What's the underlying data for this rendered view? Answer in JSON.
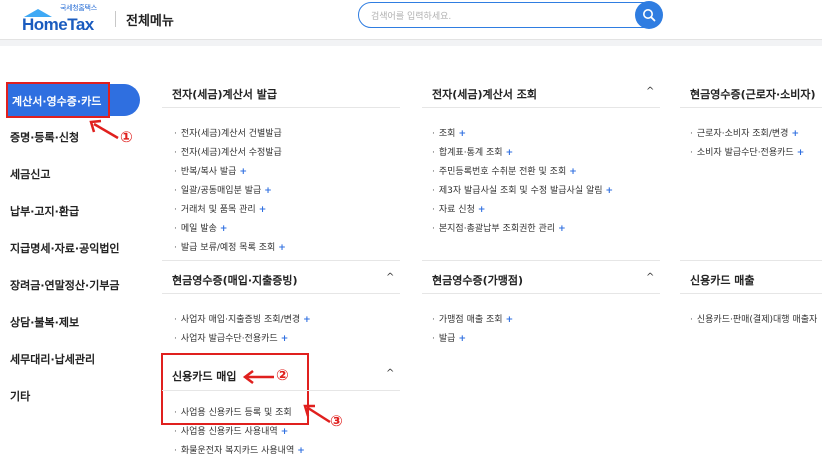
{
  "header": {
    "logo_sub": "국세청홈택스",
    "logo_text": "HomeTax",
    "title": "전체메뉴",
    "search_placeholder": "검색어를 입력하세요."
  },
  "sidebar": {
    "items": [
      "계산서·영수증·카드",
      "증명·등록·신청",
      "세금신고",
      "납부·고지·환급",
      "지급명세·자료·공익법인",
      "장려금·연말정산·기부금",
      "상담·불복·제보",
      "세무대리·납세관리",
      "기타"
    ]
  },
  "columns": {
    "c1": {
      "title": "전자(세금)계산서 발급",
      "items": [
        {
          "label": "전자(세금)계산서 건별발급",
          "plus": ""
        },
        {
          "label": "전자(세금)계산서 수정발급",
          "plus": ""
        },
        {
          "label": "반복/복사 발급",
          "plus": "+"
        },
        {
          "label": "일괄/공동매입분 발급",
          "plus": "+"
        },
        {
          "label": "거래처 및 품목 관리",
          "plus": "+"
        },
        {
          "label": "메일 발송",
          "plus": "+"
        },
        {
          "label": "발급 보류/예정 목록 조회",
          "plus": "+"
        }
      ]
    },
    "c2": {
      "title": "전자(세금)계산서 조회",
      "items": [
        {
          "label": "조회",
          "plus": "+"
        },
        {
          "label": "합계표·통계 조회",
          "plus": "+"
        },
        {
          "label": "주민등록번호 수취분 전환 및 조회",
          "plus": "+"
        },
        {
          "label": "제3자 발급사실 조회 및 수정 발급사실 알림",
          "plus": "+"
        },
        {
          "label": "자료 신청",
          "plus": "+"
        },
        {
          "label": "본지점·총괄납부 조회권한 관리",
          "plus": "+"
        }
      ]
    },
    "c3": {
      "title": "현금영수증(근로자·소비자)",
      "items": [
        {
          "label": "근로자·소비자 조회/변경",
          "plus": "+"
        },
        {
          "label": "소비자 발급수단·전용카드",
          "plus": "+"
        }
      ]
    },
    "c4": {
      "title": "현금영수증(매입·지출증빙)",
      "items": [
        {
          "label": "사업자 매입·지출증빙 조회/변경",
          "plus": "+"
        },
        {
          "label": "사업자 발급수단·전용카드",
          "plus": "+"
        }
      ]
    },
    "c5": {
      "title": "현금영수증(가맹점)",
      "items": [
        {
          "label": "가맹점 매출 조회",
          "plus": "+"
        },
        {
          "label": "발급",
          "plus": "+"
        }
      ]
    },
    "c6": {
      "title": "신용카드 매출",
      "items": [
        {
          "label": "신용카드·판매(결제)대행 매출자",
          "plus": ""
        }
      ]
    },
    "c7": {
      "title": "신용카드 매입",
      "items": [
        {
          "label": "사업용 신용카드 등록 및 조회",
          "plus": ""
        },
        {
          "label": "사업용 신용카드 사용내역",
          "plus": "+"
        },
        {
          "label": "화물운전자 복지카드 사용내역",
          "plus": "+"
        }
      ]
    }
  },
  "annotations": {
    "n1": "①",
    "n2": "②",
    "n3": "③"
  },
  "colors": {
    "accent": "#2f6fe0",
    "highlight": "#e0201e"
  }
}
